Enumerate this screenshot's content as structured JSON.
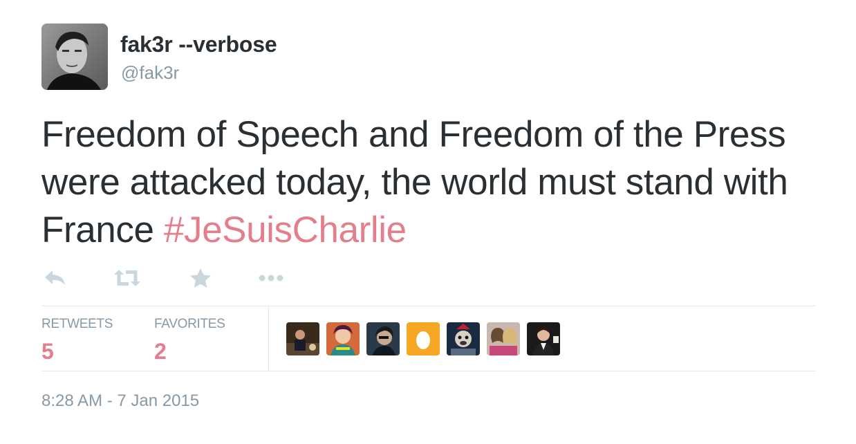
{
  "author": {
    "display_name": "fak3r --verbose",
    "handle": "@fak3r"
  },
  "tweet": {
    "text": "Freedom of Speech and Freedom of the Press were attacked today, the world must stand with France",
    "hashtag": "#JeSuisCharlie"
  },
  "actions": [
    "reply-icon",
    "retweet-icon",
    "favorite-icon",
    "more-icon"
  ],
  "stats": {
    "retweets_label": "RETWEETS",
    "retweets_count": "5",
    "favorites_label": "FAVORITES",
    "favorites_count": "2"
  },
  "favoriters_count_shown": 7,
  "timestamp": "8:28 AM - 7 Jan 2015",
  "colors": {
    "text": "#292f33",
    "muted": "#8899a6",
    "accent": "#e47e8a",
    "border": "#e1e8ed"
  }
}
